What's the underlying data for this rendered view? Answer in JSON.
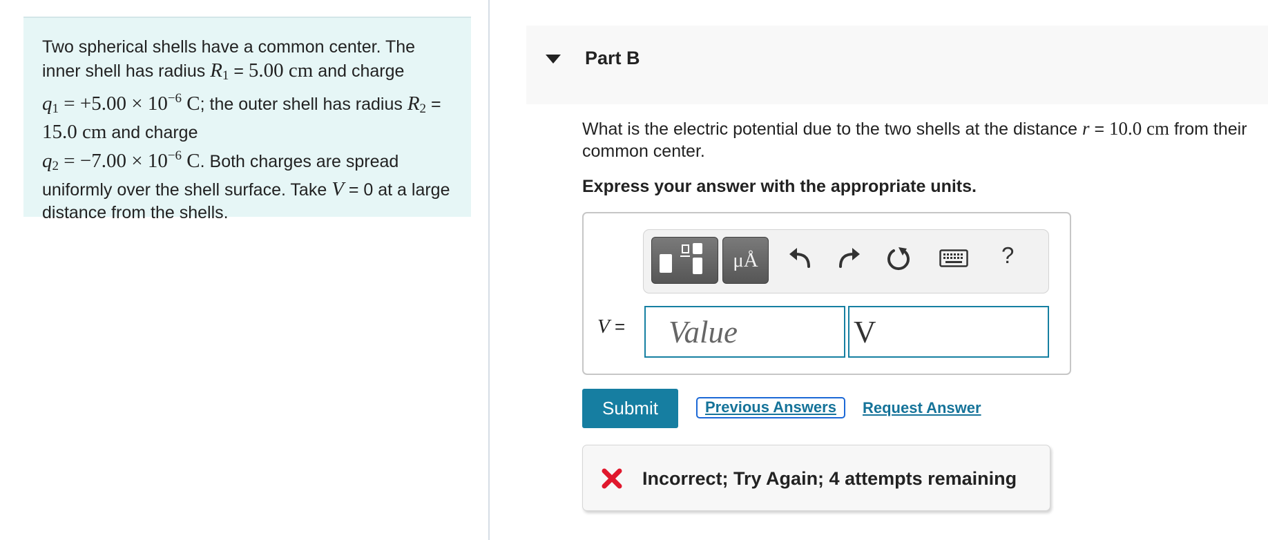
{
  "problem": {
    "intro": "Two spherical shells have a common center. The inner shell has radius ",
    "R1_symbol": "R",
    "R1_sub": "1",
    "eq1": " = ",
    "R1_value": "5.00 cm",
    "t1": " and charge ",
    "q1_symbol": "q",
    "q1_sub": "1",
    "q1_value": " = +5.00 × 10",
    "q1_exp": "−6",
    "q1_unit": " C",
    "t2": "; the outer shell has radius ",
    "R2_symbol": "R",
    "R2_sub": "2",
    "eq2": " = ",
    "R2_value": "15.0 cm",
    "t3": " and charge ",
    "q2_symbol": "q",
    "q2_sub": "2",
    "q2_value": " = −7.00 × 10",
    "q2_exp": "−6",
    "q2_unit": " C",
    "t4": ". Both charges are spread uniformly over the shell surface. Take ",
    "V_symbol": "V",
    "t5": " = 0 at a large distance from the shells."
  },
  "part": {
    "title": "Part B",
    "question_pre": "What is the electric potential due to the two shells at the distance ",
    "r_symbol": "r",
    "question_eq": " = ",
    "r_value": "10.0 cm",
    "question_post": " from their common center.",
    "instruction": "Express your answer with the appropriate units."
  },
  "toolbar": {
    "units_label": "μÅ",
    "help_label": "?",
    "icons": [
      "templates-icon",
      "units-icon",
      "undo-icon",
      "redo-icon",
      "reset-icon",
      "keyboard-icon",
      "help-icon"
    ]
  },
  "answer": {
    "var_symbol": "V",
    "var_eq": " =",
    "value_placeholder": "Value",
    "value": "",
    "unit_value": "V"
  },
  "actions": {
    "submit_label": "Submit",
    "previous_answers_label": "Previous Answers",
    "request_answer_label": "Request Answer"
  },
  "feedback": {
    "text": "Incorrect; Try Again; 4 attempts remaining",
    "status_color": "#e0182d"
  },
  "colors": {
    "accent": "#167ea1",
    "problem_bg": "#e6f6f6",
    "link": "#157399"
  }
}
